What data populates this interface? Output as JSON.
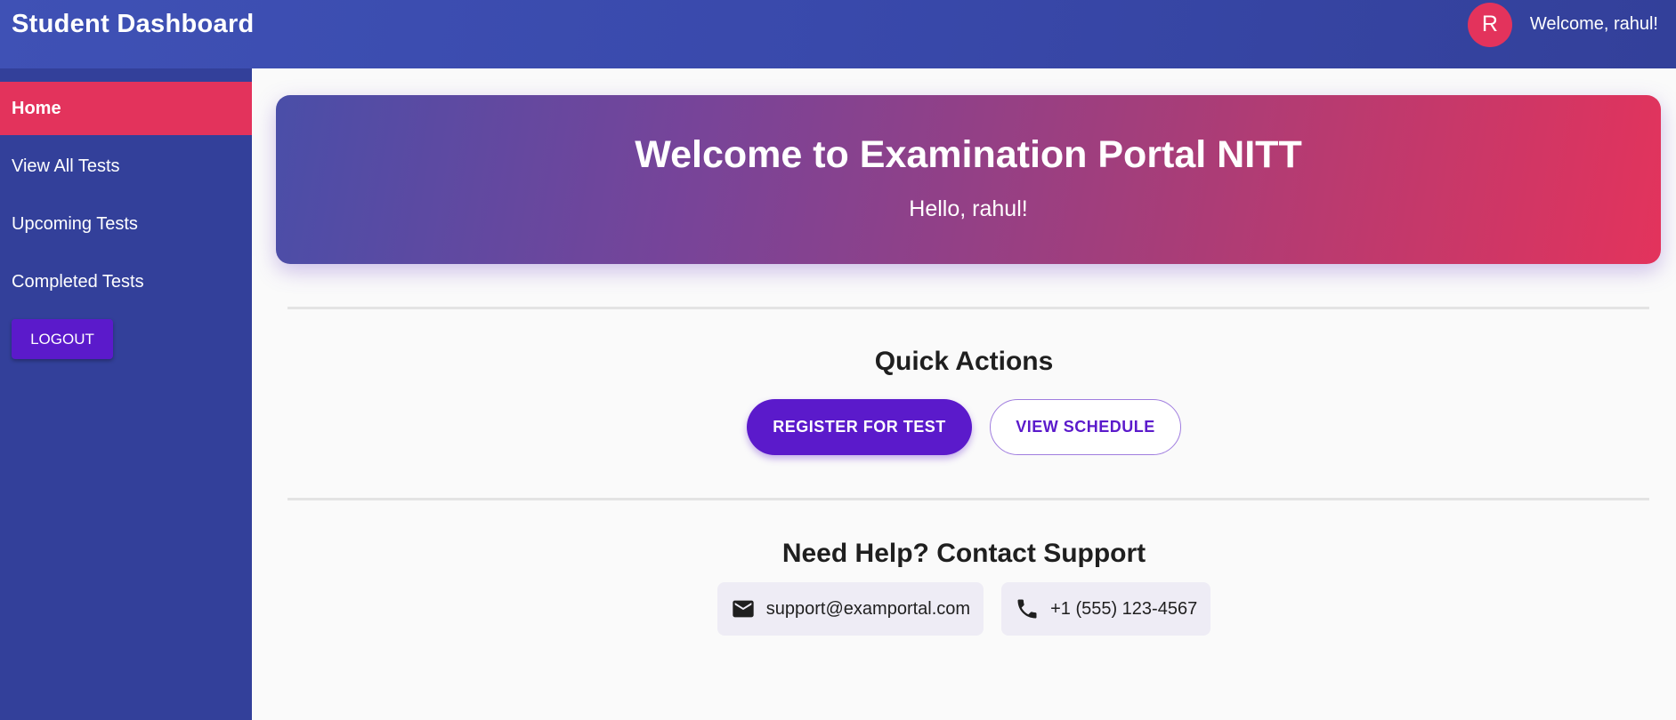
{
  "header": {
    "title": "Student Dashboard",
    "avatar_initial": "R",
    "welcome_text": "Welcome, rahul!"
  },
  "sidebar": {
    "items": [
      {
        "label": "Home",
        "active": true
      },
      {
        "label": "View All Tests",
        "active": false
      },
      {
        "label": "Upcoming Tests",
        "active": false
      },
      {
        "label": "Completed Tests",
        "active": false
      }
    ],
    "logout_label": "LOGOUT"
  },
  "banner": {
    "heading": "Welcome to Examination Portal NITT",
    "greeting": "Hello, rahul!"
  },
  "quick_actions": {
    "title": "Quick Actions",
    "register_label": "REGISTER FOR TEST",
    "schedule_label": "VIEW SCHEDULE"
  },
  "support": {
    "title": "Need Help? Contact Support",
    "email": "support@examportal.com",
    "phone": "+1 (555) 123-4567",
    "email_icon": "mail-icon",
    "phone_icon": "phone-icon"
  },
  "colors": {
    "primary": "#3f51b5",
    "sidebar": "#33409a",
    "accent": "#e3335c",
    "button": "#5b1acb"
  }
}
